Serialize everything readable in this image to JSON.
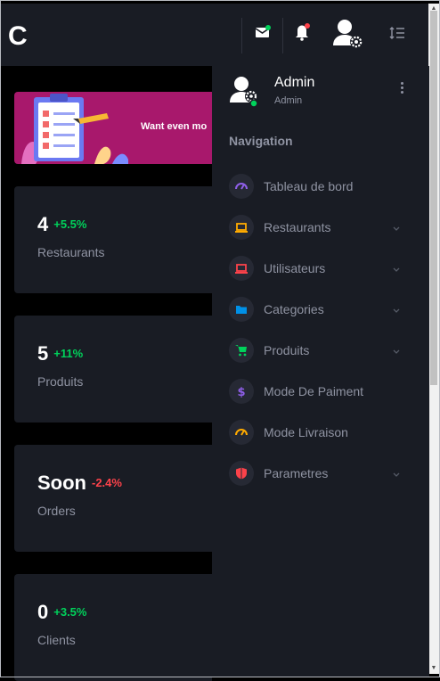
{
  "app": {
    "logo": "C"
  },
  "banner": {
    "text": "Want even mo"
  },
  "stats": [
    {
      "value": "4",
      "change": "+5.5%",
      "label": "Restaurants",
      "trend": "up"
    },
    {
      "value": "5",
      "change": "+11%",
      "label": "Produits",
      "trend": "up"
    },
    {
      "value": "Soon",
      "change": "-2.4%",
      "label": "Orders",
      "trend": "down"
    },
    {
      "value": "0",
      "change": "+3.5%",
      "label": "Clients",
      "trend": "up"
    }
  ],
  "profile": {
    "name": "Admin",
    "role": "Admin"
  },
  "nav": {
    "category": "Navigation",
    "items": [
      {
        "label": "Tableau de bord",
        "icon": "speedometer-icon",
        "color": "#8f5fe8",
        "has_submenu": false
      },
      {
        "label": "Restaurants",
        "icon": "laptop-icon",
        "color": "#ffab00",
        "has_submenu": true
      },
      {
        "label": "Utilisateurs",
        "icon": "laptop-icon",
        "color": "#fc424a",
        "has_submenu": true
      },
      {
        "label": "Categories",
        "icon": "folder-icon",
        "color": "#0090e7",
        "has_submenu": true
      },
      {
        "label": "Produits",
        "icon": "cart-icon",
        "color": "#00d25b",
        "has_submenu": true
      },
      {
        "label": "Mode De Paiment",
        "icon": "dollar-icon",
        "color": "#8f5fe8",
        "has_submenu": false
      },
      {
        "label": "Mode Livraison",
        "icon": "speedometer-icon",
        "color": "#ffab00",
        "has_submenu": false
      },
      {
        "label": "Parametres",
        "icon": "shield-icon",
        "color": "#fc424a",
        "has_submenu": true
      }
    ]
  },
  "colors": {
    "positive": "#00d25b",
    "negative": "#fc424a",
    "sidebar_bg": "#191c24",
    "page_bg": "#000000"
  }
}
